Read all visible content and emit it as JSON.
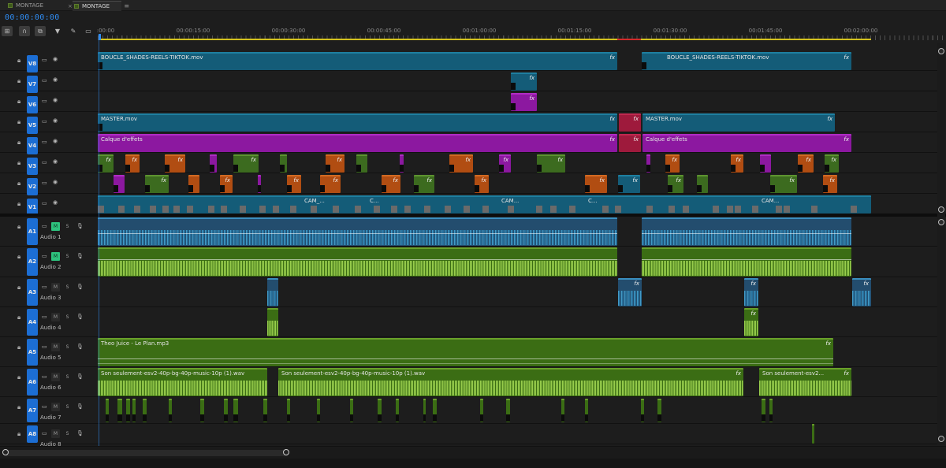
{
  "tabs": [
    {
      "label": "MONTAGE",
      "active": false
    },
    {
      "label": "MONTAGE",
      "active": true
    }
  ],
  "tab_close": "×",
  "tab_menu": "≡",
  "timecode": "00:00:00:00",
  "ruler_labels": [
    ":00:00",
    "00:00:15:00",
    "00:00:30:00",
    "00:00:45:00",
    "00:01:00:00",
    "00:01:15:00",
    "00:01:30:00",
    "00:01:45:00",
    "00:02:00:00"
  ],
  "video_tracks": [
    {
      "id": "V8",
      "label": "V8"
    },
    {
      "id": "V7",
      "label": "V7"
    },
    {
      "id": "V6",
      "label": "V6"
    },
    {
      "id": "V5",
      "label": "V5"
    },
    {
      "id": "V4",
      "label": "V4"
    },
    {
      "id": "V3",
      "label": "V3"
    },
    {
      "id": "V2",
      "label": "V2"
    },
    {
      "id": "V1",
      "label": "V1"
    }
  ],
  "audio_tracks": [
    {
      "id": "A1",
      "name": "Audio 1",
      "mute_on": true
    },
    {
      "id": "A2",
      "name": "Audio 2",
      "mute_on": true
    },
    {
      "id": "A3",
      "name": "Audio 3",
      "mute_on": false
    },
    {
      "id": "A4",
      "name": "Audio 4",
      "mute_on": false
    },
    {
      "id": "A5",
      "name": "Audio 5",
      "mute_on": false
    },
    {
      "id": "A6",
      "name": "Audio 6",
      "mute_on": false
    },
    {
      "id": "A7",
      "name": "Audio 7",
      "mute_on": false
    },
    {
      "id": "A8",
      "name": "Audio 8",
      "mute_on": false
    }
  ],
  "audio_btn": {
    "m": "M",
    "s": "S"
  },
  "clip_names": {
    "v8a": "BOUCLE_SHADES-REELS-TIKTOK.mov",
    "v8b": "BOUCLE_SHADES-REELS-TIKTOK.mov",
    "v5a": "MASTER.mov",
    "v5b": "MASTER.mov",
    "v4a": "Calque d'effets",
    "v4b": "Calque d'effets",
    "v1a": "CAM_...",
    "v1b": "C...",
    "v1c": "CAM...",
    "v1d": "C...",
    "v1e": "CAM...",
    "a5": "Theo Juice - Le Plan.mp3",
    "a6a": "Son seulement-esv2-40p-bg-40p-music-10p (1).wav",
    "a6b": "Son seulement-esv2-40p-bg-40p-music-10p (1).wav",
    "a6c": "Son seulement-esv2..."
  },
  "fx_label": "fx",
  "icons": {
    "lock": "lock-icon",
    "eye": "eye-icon",
    "sync": "sync-lock-icon",
    "mic": "microphone-icon"
  },
  "colors": {
    "accent": "#2f8cf2",
    "video_clip": "#145c78",
    "adjustment_layer": "#8c18a0",
    "green_clip": "#3c6b1f",
    "orange_clip": "#b14d12",
    "red_clip": "#9e1a3c",
    "audio_clip": "#3b6d14"
  }
}
